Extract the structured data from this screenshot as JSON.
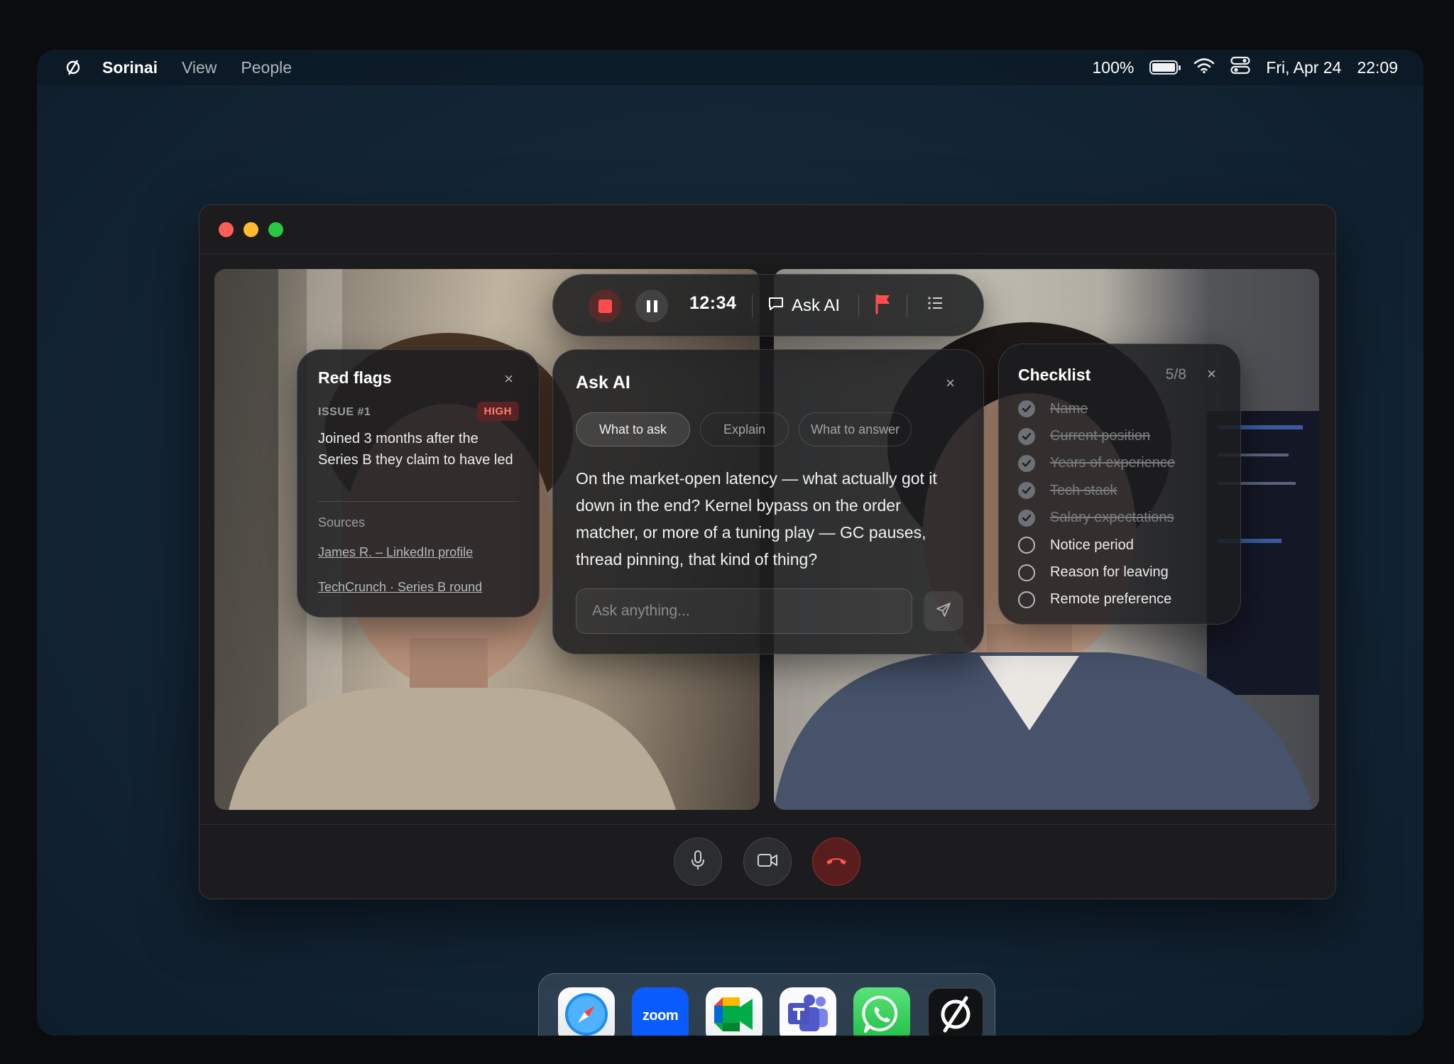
{
  "menubar": {
    "logo_icon": "sorinai-logo-icon",
    "app_name": "Sorinai",
    "menus": [
      "View",
      "People"
    ],
    "battery": "100%",
    "battery_level": 1.0,
    "date": "Fri, Apr 24",
    "time": "22:09"
  },
  "window": {
    "controls": [
      "close",
      "minimize",
      "maximize"
    ]
  },
  "toolbar": {
    "timer": "12:34",
    "ask_label": "Ask AI",
    "stop_color": "#ff4d4d",
    "flag_color": "#ff4d4d"
  },
  "red_flags": {
    "title": "Red flags",
    "close": "×",
    "issue_label": "ISSUE #1",
    "severity": "HIGH",
    "text": "Joined 3 months after the Series B they claim to have led",
    "sources_label": "Sources",
    "sources": [
      "James R. – LinkedIn profile",
      "TechCrunch · Series B round"
    ]
  },
  "ask_ai": {
    "title": "Ask AI",
    "close": "×",
    "chips": [
      "What to ask",
      "Explain",
      "What to answer"
    ],
    "active_chip": "What to ask",
    "answer": "On the market-open latency — what actually got it down in the end? Kernel bypass on the order matcher, or more of a tuning play — GC pauses, thread pinning, that kind of thing?",
    "input_placeholder": "Ask anything..."
  },
  "checklist": {
    "title": "Checklist",
    "count": "5/8",
    "close": "×",
    "items": [
      {
        "label": "Name",
        "done": true
      },
      {
        "label": "Current position",
        "done": true
      },
      {
        "label": "Years of experience",
        "done": true
      },
      {
        "label": "Tech stack",
        "done": true
      },
      {
        "label": "Salary expectations",
        "done": true
      },
      {
        "label": "Notice period",
        "done": false
      },
      {
        "label": "Reason for leaving",
        "done": false
      },
      {
        "label": "Remote preference",
        "done": false
      }
    ]
  },
  "call_controls": [
    "microphone",
    "camera",
    "end-call"
  ],
  "dock": {
    "apps": [
      "Safari",
      "Zoom",
      "Google Meet",
      "Microsoft Teams",
      "WhatsApp",
      "Sorinai"
    ],
    "zoom_text": "zoom"
  }
}
